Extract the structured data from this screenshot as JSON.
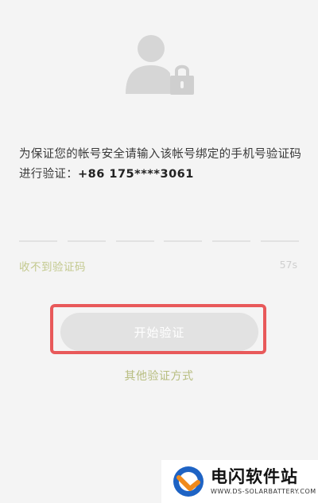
{
  "prompt": {
    "text": "为保证您的帐号安全请输入该帐号绑定的手机号验证码进行验证：",
    "phone": "+86 175****3061"
  },
  "code_input": {
    "slots": 6
  },
  "resend": {
    "label": "收不到验证码",
    "countdown": "57s"
  },
  "verify_button": {
    "label": "开始验证"
  },
  "other_methods": {
    "label": "其他验证方式"
  },
  "watermark": {
    "name": "电闪软件站",
    "url": "WWW.DS-SOLARBATTERY.COM"
  },
  "colors": {
    "background": "#f4f4f4",
    "highlight": "#e8595a",
    "link": "#b7bd7f",
    "button_disabled": "#e2e2e2"
  },
  "icons": {
    "avatar": "user-lock-icon",
    "logo": "watermark-logo-icon"
  }
}
